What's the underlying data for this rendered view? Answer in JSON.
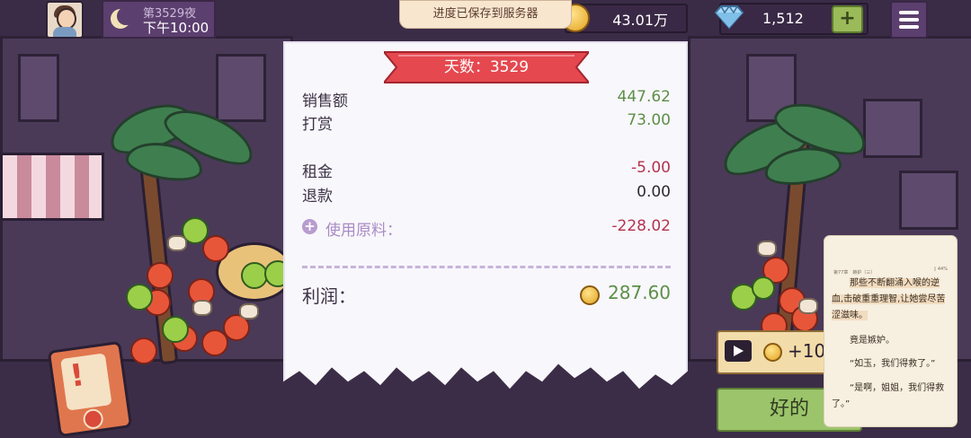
{
  "hud": {
    "night_label": "第3529夜",
    "time_label": "下午10:00",
    "save_toast": "进度已保存到服务器",
    "coins": "43.01万",
    "gems": "1,512",
    "add_gems_label": "+"
  },
  "icons": {
    "avatar": "player-avatar",
    "moon": "moon-icon",
    "coin": "coin-icon",
    "gem": "diamond-icon",
    "menu": "hamburger-menu-icon",
    "play": "video-play-icon",
    "alert": "exclamation-alert-icon",
    "plus": "plus-circle-icon"
  },
  "receipt": {
    "day_title": "天数：3529",
    "sales_label": "销售额",
    "sales_value": "447.62",
    "tips_label": "打赏",
    "tips_value": "73.00",
    "rent_label": "租金",
    "rent_value": "-5.00",
    "refund_label": "退款",
    "refund_value": "0.00",
    "materials_label": "使用原料：",
    "materials_value": "-228.02",
    "profit_label": "利润：",
    "profit_value": "287.60"
  },
  "buttons": {
    "ad_reward_label": "+10",
    "ok_label": "好的"
  },
  "reader": {
    "header_left": "第77章　嫉妒（三）",
    "header_right": "▯ 44%",
    "para1": "那些不断翻涌入喉的逆血,击破重重理智,让她尝尽苦涩滋味。",
    "para2": "竟是嫉妒。",
    "para3": "“如玉，我们得救了。”",
    "para4": "“是啊，姐姐，我们得救了。”"
  },
  "colors": {
    "profit_green": "#5c8f48",
    "expense_red": "#b3344f",
    "ribbon_red": "#e5484f",
    "button_green": "#9cc46b"
  }
}
